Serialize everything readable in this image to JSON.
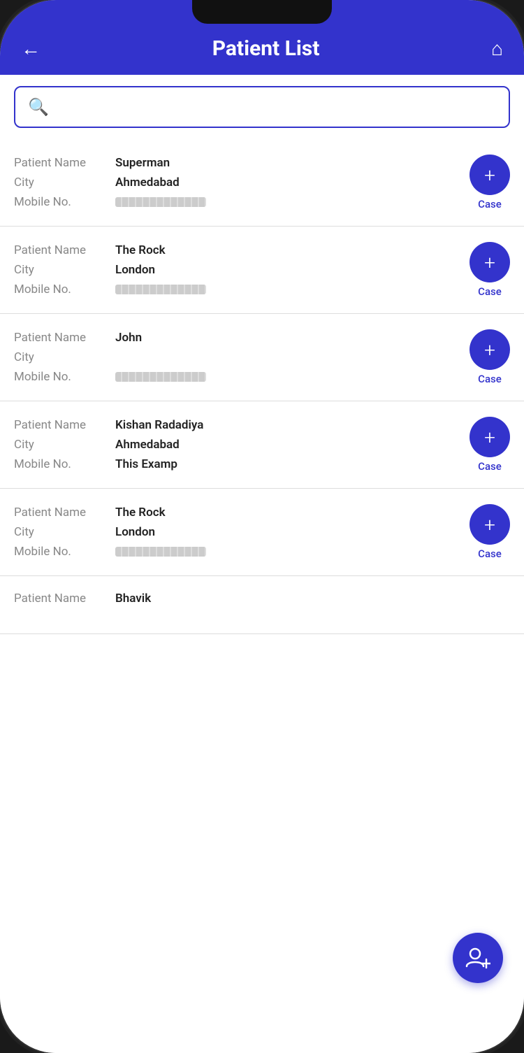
{
  "header": {
    "back_label": "←",
    "title": "Patient List",
    "home_label": "⌂"
  },
  "search": {
    "placeholder": ""
  },
  "case_button_label": "Case",
  "patients": [
    {
      "id": 1,
      "name": "Superman",
      "city": "Ahmedabad",
      "mobile": "redacted"
    },
    {
      "id": 2,
      "name": "The Rock",
      "city": "London",
      "mobile": "redacted"
    },
    {
      "id": 3,
      "name": "John",
      "city": "",
      "mobile": "redacted"
    },
    {
      "id": 4,
      "name": "Kishan Radadiya",
      "city": "Ahmedabad",
      "mobile": "This Examp"
    },
    {
      "id": 5,
      "name": "The Rock",
      "city": "London",
      "mobile": "redacted"
    },
    {
      "id": 6,
      "name": "Bhavik",
      "city": "",
      "mobile": ""
    }
  ],
  "labels": {
    "patient_name": "Patient Name",
    "city": "City",
    "mobile_no": "Mobile No."
  }
}
